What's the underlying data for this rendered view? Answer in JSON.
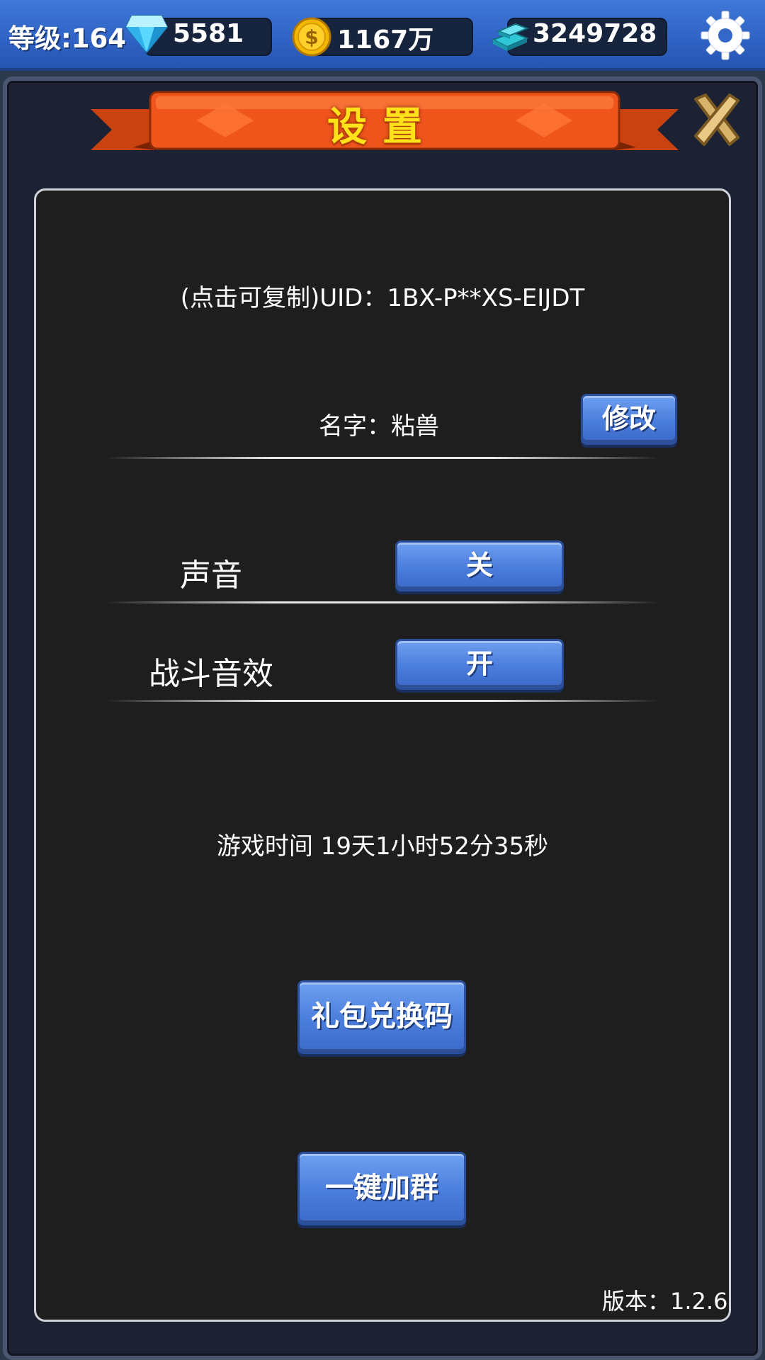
{
  "topbar": {
    "level": "等级:164",
    "diamonds": "5581",
    "gold": "1167万",
    "ingots": "3249728",
    "icons": [
      "diamond-icon",
      "gold-coin-icon",
      "ingot-icon",
      "gear-icon"
    ]
  },
  "dialog": {
    "title": "设置",
    "uid": "(点击可复制)UID：1BX-P**XS-EIJDT",
    "name": "名字：粘兽",
    "rename_button": "修改",
    "sound_label": "声音",
    "sound_button": "关",
    "battle_sfx_label": "战斗音效",
    "battle_sfx_button": "开",
    "play_time": "游戏时间 19天1小时52分35秒",
    "gift_code_button": "礼包兑换码",
    "join_group_button": "一键加群",
    "version": "版本：1.2.6"
  },
  "colors": {
    "title": "#ffe21a",
    "ribbon": "#f0561c",
    "button": "#4a7ddc",
    "topbar": "#3468c8"
  }
}
